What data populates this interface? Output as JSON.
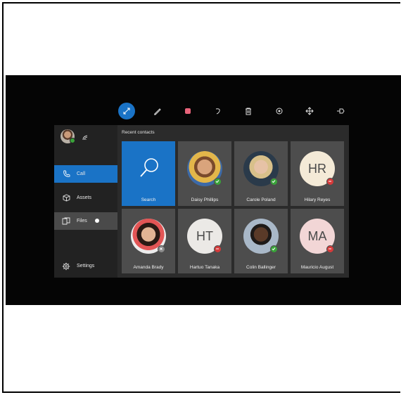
{
  "toolbar": {
    "items": [
      {
        "icon": "pointer-icon",
        "active": true
      },
      {
        "icon": "pen-icon"
      },
      {
        "icon": "color-swatch-icon",
        "color": "#e8637a"
      },
      {
        "icon": "undo-icon"
      },
      {
        "icon": "trash-icon"
      },
      {
        "icon": "settings-icon"
      },
      {
        "icon": "move-icon"
      },
      {
        "icon": "pin-icon"
      }
    ]
  },
  "sidebar": {
    "items": [
      {
        "label": "Call",
        "icon": "phone-icon",
        "selected": true
      },
      {
        "label": "Assets",
        "icon": "cube-icon"
      },
      {
        "label": "Files",
        "icon": "files-icon"
      },
      {
        "label": "Settings",
        "icon": "gear-icon"
      }
    ]
  },
  "recent": {
    "title": "Recent contacts",
    "search_label": "Search",
    "contacts": [
      {
        "name": "Daisy Phillips",
        "status": "online",
        "type": "photo"
      },
      {
        "name": "Carole Poland",
        "status": "online",
        "type": "photo"
      },
      {
        "name": "Hilary Reyes",
        "initials": "HR",
        "status": "busy",
        "type": "initials",
        "bg": "#f4ead7"
      },
      {
        "name": "Amanda Brady",
        "status": "offline",
        "type": "photo"
      },
      {
        "name": "Hartuo Tanaka",
        "initials": "HT",
        "status": "busy",
        "type": "initials",
        "bg": "#ebe9e6"
      },
      {
        "name": "Colin Ballinger",
        "status": "online",
        "type": "photo"
      },
      {
        "name": "Mauricio August",
        "initials": "MA",
        "status": "busy",
        "type": "initials",
        "bg": "#f2d6d6"
      }
    ]
  },
  "colors": {
    "accent": "#1a73c6",
    "online": "#3aa33a",
    "busy": "#d63b3b"
  }
}
